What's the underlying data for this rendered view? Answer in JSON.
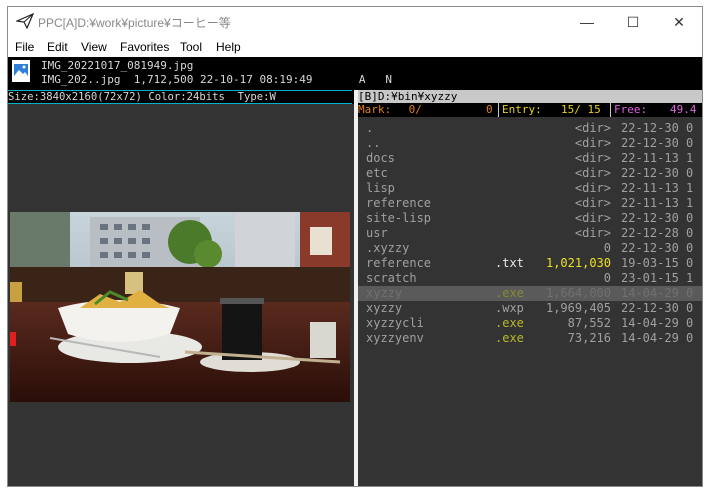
{
  "window": {
    "title": "PPC[A]D:¥work¥picture¥コーヒー等",
    "minimize_glyph": "—",
    "maximize_glyph": "☐",
    "close_glyph": "✕"
  },
  "menu": [
    "File",
    "Edit",
    "View",
    "Favorites",
    "Tool",
    "Help"
  ],
  "info": {
    "line1": "IMG_20221017_081949.jpg",
    "line2": "IMG_202..jpg  1,712,500 22-10-17 08:19:49       A   N"
  },
  "viewer": {
    "size_line": "Size:3840x2160(72x72) Color:24bits  Type:W"
  },
  "filelist": {
    "path": "[B]D:¥bin¥xyzzy",
    "mark_label": "Mark:",
    "mark_value": " 0/",
    "mark_size": "0",
    "entry_label": "Entry:",
    "entry_value": "15/ 15",
    "free_label": "Free:",
    "free_value": "49.4",
    "entries": [
      {
        "name": ".",
        "ext": "",
        "size": "<dir>",
        "date": "22-12-30 0",
        "color": "#a0a0a0",
        "extcolor": "#a0a0a0",
        "sizecolor": "#a0a0a0"
      },
      {
        "name": "..",
        "ext": "",
        "size": "<dir>",
        "date": "22-12-30 0",
        "color": "#a0a0a0",
        "extcolor": "#a0a0a0",
        "sizecolor": "#a0a0a0"
      },
      {
        "name": "docs",
        "ext": "",
        "size": "<dir>",
        "date": "22-11-13 1",
        "color": "#a0a0a0",
        "extcolor": "#a0a0a0",
        "sizecolor": "#a0a0a0"
      },
      {
        "name": "etc",
        "ext": "",
        "size": "<dir>",
        "date": "22-12-30 0",
        "color": "#a0a0a0",
        "extcolor": "#a0a0a0",
        "sizecolor": "#a0a0a0"
      },
      {
        "name": "lisp",
        "ext": "",
        "size": "<dir>",
        "date": "22-11-13 1",
        "color": "#a0a0a0",
        "extcolor": "#a0a0a0",
        "sizecolor": "#a0a0a0"
      },
      {
        "name": "reference",
        "ext": "",
        "size": "<dir>",
        "date": "22-11-13 1",
        "color": "#a0a0a0",
        "extcolor": "#a0a0a0",
        "sizecolor": "#a0a0a0"
      },
      {
        "name": "site-lisp",
        "ext": "",
        "size": "<dir>",
        "date": "22-12-30 0",
        "color": "#a0a0a0",
        "extcolor": "#a0a0a0",
        "sizecolor": "#a0a0a0"
      },
      {
        "name": "usr",
        "ext": "",
        "size": "<dir>",
        "date": "22-12-28 0",
        "color": "#a0a0a0",
        "extcolor": "#a0a0a0",
        "sizecolor": "#a0a0a0"
      },
      {
        "name": ".xyzzy",
        "ext": "",
        "size": "0",
        "date": "22-12-30 0",
        "color": "#a0a0a0",
        "extcolor": "#a0a0a0",
        "sizecolor": "#a0a0a0"
      },
      {
        "name": "reference",
        "ext": ".txt",
        "size": "1,021,030",
        "date": "19-03-15 0",
        "color": "#a0a0a0",
        "extcolor": "#e8e8e8",
        "sizecolor": "#f0e020"
      },
      {
        "name": "scratch",
        "ext": "",
        "size": "0",
        "date": "23-01-15 1",
        "color": "#a0a0a0",
        "extcolor": "#a0a0a0",
        "sizecolor": "#a0a0a0"
      },
      {
        "name": "xyzzy",
        "ext": ".exe",
        "size": "1,664,000",
        "date": "14-04-29 0",
        "color": "#707070",
        "extcolor": "#8a8a30",
        "sizecolor": "#707070",
        "cursor": true
      },
      {
        "name": "xyzzy",
        "ext": ".wxp",
        "size": "1,969,405",
        "date": "22-12-30 0",
        "color": "#a0a0a0",
        "extcolor": "#a0a0a0",
        "sizecolor": "#a0a0a0"
      },
      {
        "name": "xyzzycli",
        "ext": ".exe",
        "size": "87,552",
        "date": "14-04-29 0",
        "color": "#a0a0a0",
        "extcolor": "#b8b828",
        "sizecolor": "#a0a0a0"
      },
      {
        "name": "xyzzyenv",
        "ext": ".exe",
        "size": "73,216",
        "date": "14-04-29 0",
        "color": "#a0a0a0",
        "extcolor": "#b8b828",
        "sizecolor": "#a0a0a0"
      }
    ]
  },
  "colors": {
    "accent_cyan": "#00b0c8",
    "stat_orange": "#e08010",
    "stat_yellow": "#f0e020",
    "free_magenta": "#e060e0"
  }
}
